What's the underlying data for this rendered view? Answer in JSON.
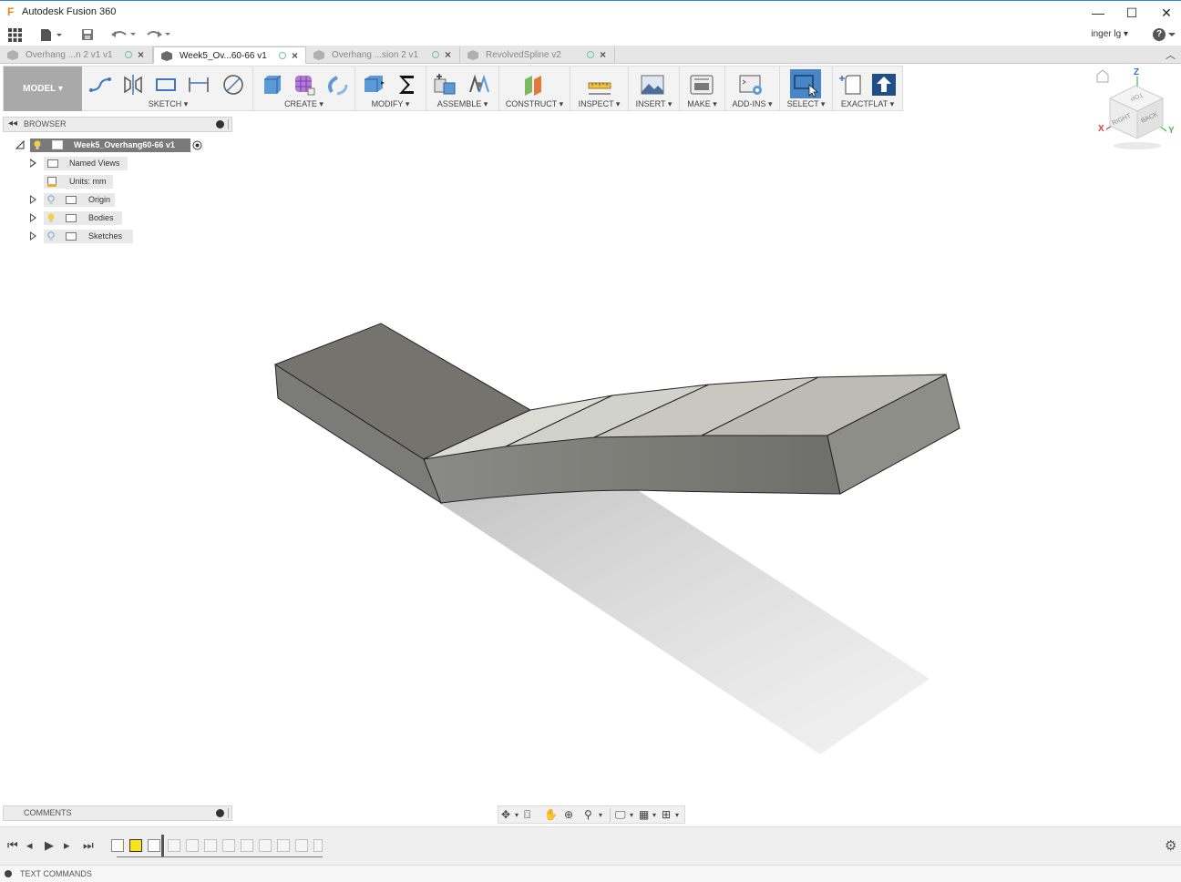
{
  "window": {
    "title": "Autodesk Fusion 360",
    "minimize": "—",
    "maximize": "☐",
    "close": "✕"
  },
  "quick_access": {
    "user": "inger lg ▾",
    "help": "?"
  },
  "tabs": [
    {
      "label": "Overhang ...n 2 v1 v1",
      "active": false
    },
    {
      "label": "Week5_Ov...60-66 v1",
      "active": true
    },
    {
      "label": "Overhang ...sion 2 v1",
      "active": false
    },
    {
      "label": "RevolvedSpline v2",
      "active": false
    }
  ],
  "toolbar": {
    "workspace": "MODEL ▾",
    "groups": [
      {
        "label": "SKETCH ▾"
      },
      {
        "label": "CREATE ▾"
      },
      {
        "label": "MODIFY ▾"
      },
      {
        "label": "ASSEMBLE ▾"
      },
      {
        "label": "CONSTRUCT ▾"
      },
      {
        "label": "INSPECT ▾"
      },
      {
        "label": "INSERT ▾"
      },
      {
        "label": "MAKE ▾"
      },
      {
        "label": "ADD-INS ▾"
      },
      {
        "label": "SELECT ▾"
      },
      {
        "label": "EXACTFLAT ▾"
      }
    ]
  },
  "browser": {
    "title": "BROWSER",
    "root": "Week5_Overhang60-66 v1",
    "items": [
      {
        "label": "Named Views"
      },
      {
        "label": "Units: mm"
      },
      {
        "label": "Origin"
      },
      {
        "label": "Bodies"
      },
      {
        "label": "Sketches"
      }
    ]
  },
  "viewcube": {
    "z": "Z",
    "x": "X",
    "y": "Y",
    "right": "RIGHT",
    "back": "BACK",
    "top": "TOP"
  },
  "comments": {
    "title": "COMMENTS"
  },
  "textcommands": {
    "title": "TEXT COMMANDS"
  },
  "colors": {
    "accent_select": "#4a86c5",
    "window_border": "#2b88d8",
    "model_button": "#a9a9a9"
  }
}
